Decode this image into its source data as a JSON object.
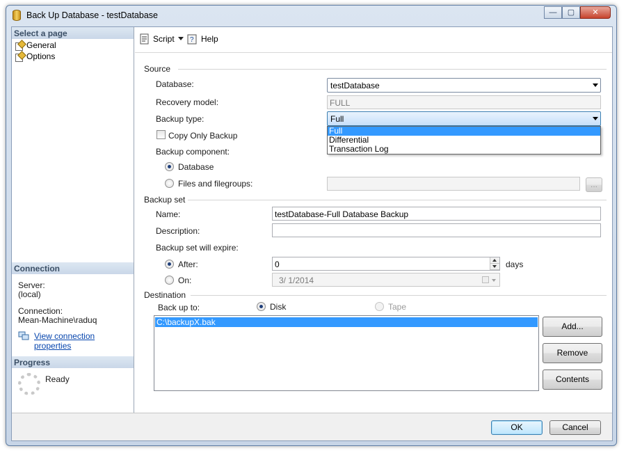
{
  "window": {
    "title": "Back Up Database - testDatabase",
    "controls": {
      "minimize": "—",
      "maximize": "▢",
      "close": "✕"
    }
  },
  "left_pane": {
    "select_page_header": "Select a page",
    "pages": [
      {
        "label": "General",
        "icon": "page-icon"
      },
      {
        "label": "Options",
        "icon": "page-icon"
      }
    ],
    "connection_header": "Connection",
    "server_label": "Server:",
    "server_value": "(local)",
    "connection_label": "Connection:",
    "connection_value": "Mean-Machine\\raduq",
    "view_connection_link": "View connection properties",
    "progress_header": "Progress",
    "progress_status": "Ready"
  },
  "toolbar": {
    "script_label": "Script",
    "help_label": "Help"
  },
  "source": {
    "group_label": "Source",
    "database_label": "Database:",
    "database_value": "testDatabase",
    "recovery_model_label": "Recovery model:",
    "recovery_model_value": "FULL",
    "backup_type_label": "Backup type:",
    "backup_type_value": "Full",
    "backup_type_options": [
      "Full",
      "Differential",
      "Transaction Log"
    ],
    "copy_only_label": "Copy Only Backup",
    "backup_component_label": "Backup component:",
    "component_database_label": "Database",
    "component_files_label": "Files and filegroups:",
    "browse_button": "..."
  },
  "backup_set": {
    "group_label": "Backup set",
    "name_label": "Name:",
    "name_value": "testDatabase-Full Database Backup",
    "description_label": "Description:",
    "description_value": "",
    "expire_label": "Backup set will expire:",
    "after_label": "After:",
    "after_value": "0",
    "days_label": "days",
    "on_label": "On:",
    "on_value": "3/  1/2014"
  },
  "destination": {
    "group_label": "Destination",
    "backup_to_label": "Back up to:",
    "disk_label": "Disk",
    "tape_label": "Tape",
    "files": [
      "C:\\backupX.bak"
    ],
    "add_button": "Add...",
    "remove_button": "Remove",
    "contents_button": "Contents"
  },
  "footer": {
    "ok_button": "OK",
    "cancel_button": "Cancel"
  }
}
